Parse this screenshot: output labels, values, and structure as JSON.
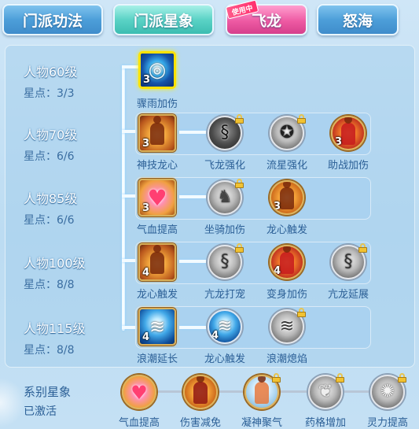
{
  "tabs": [
    {
      "label": "门派功法",
      "style": "blue"
    },
    {
      "label": "门派星象",
      "style": "teal",
      "active": true
    },
    {
      "label": "飞龙",
      "style": "pink",
      "badge": "使用中"
    },
    {
      "label": "怒海",
      "style": "blue"
    }
  ],
  "rows": [
    {
      "level": "人物60级",
      "points": "星点：3/3",
      "main": {
        "label": "骤雨加伤",
        "level": "3",
        "icon": "rain-swirl-icon",
        "selected": true
      },
      "subs": []
    },
    {
      "level": "人物70级",
      "points": "星点：6/6",
      "main": {
        "label": "神技龙心",
        "level": "3",
        "icon": "dragon-heart-icon"
      },
      "subs": [
        {
          "label": "飞龙强化",
          "level": "",
          "icon": "black-dragon-icon",
          "locked": true
        },
        {
          "label": "流星强化",
          "level": "",
          "icon": "meteor-icon",
          "locked": true
        },
        {
          "label": "助战加伤",
          "level": "3",
          "icon": "assist-damage-icon",
          "locked": false
        }
      ]
    },
    {
      "level": "人物85级",
      "points": "星点：6/6",
      "main": {
        "label": "气血提高",
        "level": "3",
        "icon": "heart-icon"
      },
      "subs": [
        {
          "label": "坐骑加伤",
          "level": "",
          "icon": "mount-icon",
          "locked": true
        },
        {
          "label": "龙心触发",
          "level": "3",
          "icon": "dragon-trigger-icon",
          "locked": false
        }
      ]
    },
    {
      "level": "人物100级",
      "points": "星点：8/8",
      "main": {
        "label": "龙心触发",
        "level": "4",
        "icon": "dragon-heart-icon"
      },
      "subs": [
        {
          "label": "亢龙打宠",
          "level": "",
          "icon": "gray-dragon-icon",
          "locked": true
        },
        {
          "label": "变身加伤",
          "level": "4",
          "icon": "transform-icon",
          "locked": false
        },
        {
          "label": "亢龙延展",
          "level": "",
          "icon": "gray-dragon-icon",
          "locked": true
        }
      ]
    },
    {
      "level": "人物115级",
      "points": "星点：8/8",
      "main": {
        "label": "浪潮延长",
        "level": "4",
        "icon": "wave-icon"
      },
      "subs": [
        {
          "label": "龙心触发",
          "level": "4",
          "icon": "wave-icon",
          "locked": false
        },
        {
          "label": "浪潮熄焰",
          "level": "",
          "icon": "gray-wave-icon",
          "locked": true
        }
      ]
    }
  ],
  "series": {
    "title": "系别星象",
    "status": "已激活",
    "items": [
      {
        "label": "气血提高",
        "icon": "heart-icon",
        "locked": false
      },
      {
        "label": "伤害减免",
        "icon": "shield-figure-icon",
        "locked": false
      },
      {
        "label": "凝神聚气",
        "icon": "frost-figure-icon",
        "locked": true
      },
      {
        "label": "药格增加",
        "icon": "herb-icon",
        "locked": true
      },
      {
        "label": "灵力提高",
        "icon": "spirit-icon",
        "locked": true
      }
    ]
  }
}
